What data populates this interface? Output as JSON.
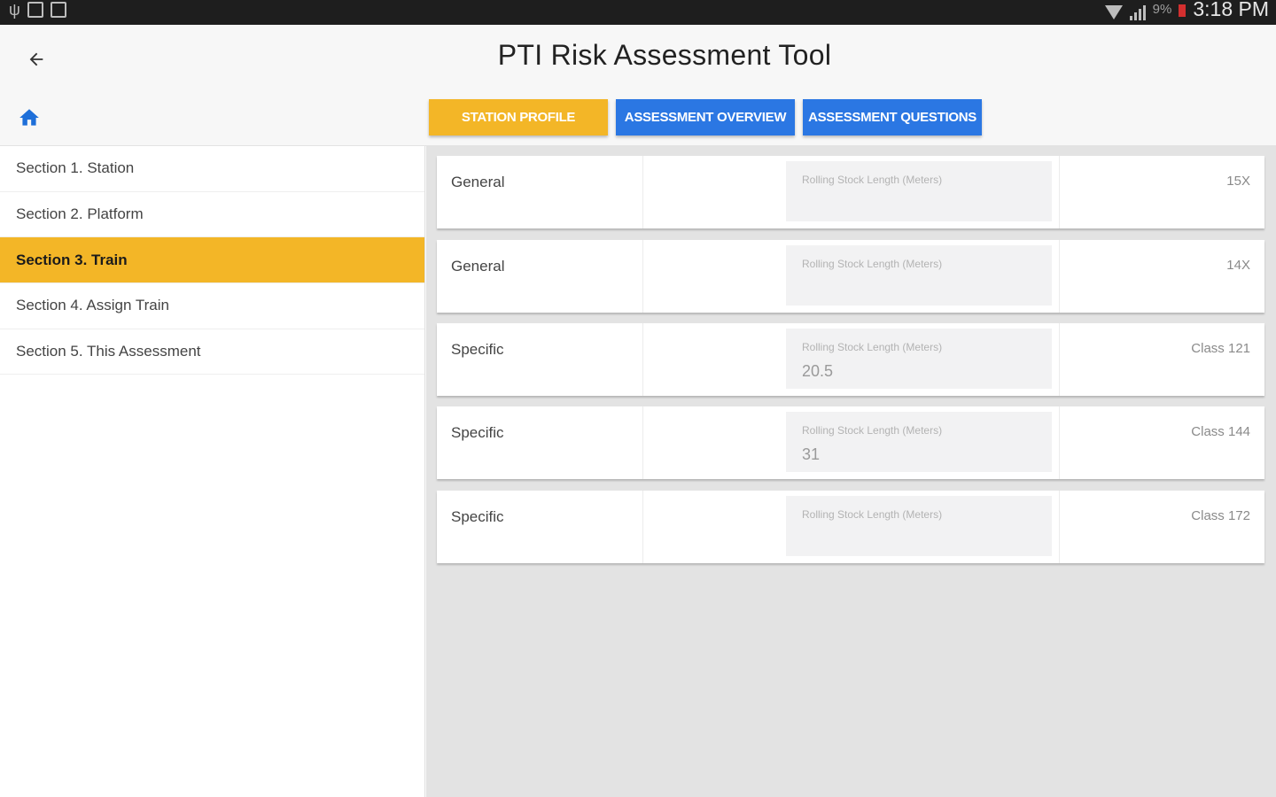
{
  "status_bar": {
    "left_icons": [
      "usb-icon",
      "sim-icon",
      "screenshot-icon"
    ],
    "battery": "9%",
    "time": "3:18 PM"
  },
  "app_bar": {
    "title": "PTI Risk Assessment Tool",
    "back_icon": "arrow-left-icon",
    "home_icon": "home-icon",
    "tabs": [
      {
        "label": "STATION PROFILE",
        "color": "#f3b627"
      },
      {
        "label": "ASSESSMENT OVERVIEW",
        "color": "#2b77e3"
      },
      {
        "label": "ASSESSMENT QUESTIONS",
        "color": "#2b77e3"
      }
    ]
  },
  "sidebar": {
    "active_index": 2,
    "items": [
      {
        "label": "Section 1. Station"
      },
      {
        "label": "Section 2. Platform"
      },
      {
        "label": "Section 3. Train"
      },
      {
        "label": "Section 4. Assign Train"
      },
      {
        "label": "Section 5. This Assessment"
      }
    ]
  },
  "cards": [
    {
      "category": "General",
      "field_label": "Rolling Stock Length (Meters)",
      "field_value": "",
      "train_type": "15X"
    },
    {
      "category": "General",
      "field_label": "Rolling Stock Length (Meters)",
      "field_value": "",
      "train_type": "14X"
    },
    {
      "category": "Specific",
      "field_label": "Rolling Stock Length (Meters)",
      "field_value": "20.5",
      "train_type": "Class 121"
    },
    {
      "category": "Specific",
      "field_label": "Rolling Stock Length (Meters)",
      "field_value": "31",
      "train_type": "Class 144"
    },
    {
      "category": "Specific",
      "field_label": "Rolling Stock Length (Meters)",
      "field_value": "",
      "train_type": "Class 172"
    }
  ],
  "colors": {
    "accent_yellow": "#f3b627",
    "accent_blue": "#2b77e3",
    "home_icon": "#1e6fd9"
  }
}
